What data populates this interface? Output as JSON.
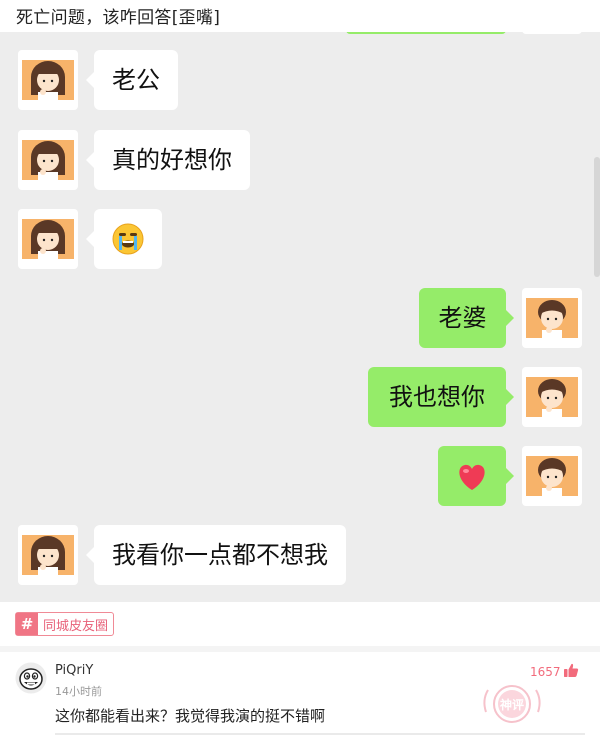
{
  "post": {
    "title": "死亡问题，该咋回答[歪嘴]"
  },
  "chat": {
    "messages": [
      {
        "side": "left",
        "text": "老公"
      },
      {
        "side": "left",
        "text": "真的好想你"
      },
      {
        "side": "left",
        "emoji": "crying-face"
      },
      {
        "side": "right",
        "text": "老婆"
      },
      {
        "side": "right",
        "text": "我也想你"
      },
      {
        "side": "right",
        "emoji": "red-heart"
      },
      {
        "side": "left",
        "text": "我看你一点都不想我"
      }
    ]
  },
  "tag": {
    "icon": "#",
    "label": "同城皮友圈"
  },
  "comment": {
    "username": "PiQriY",
    "time": "14小时前",
    "text": "这你都能看出来？我觉得我演的挺不错啊",
    "likes": "1657",
    "stamp_text": "神评"
  },
  "colors": {
    "chat_bg": "#ededed",
    "bubble_self": "#95ec69",
    "bubble_other": "#ffffff",
    "tag_pink": "#f07585",
    "like_pink": "#f26b7c"
  }
}
